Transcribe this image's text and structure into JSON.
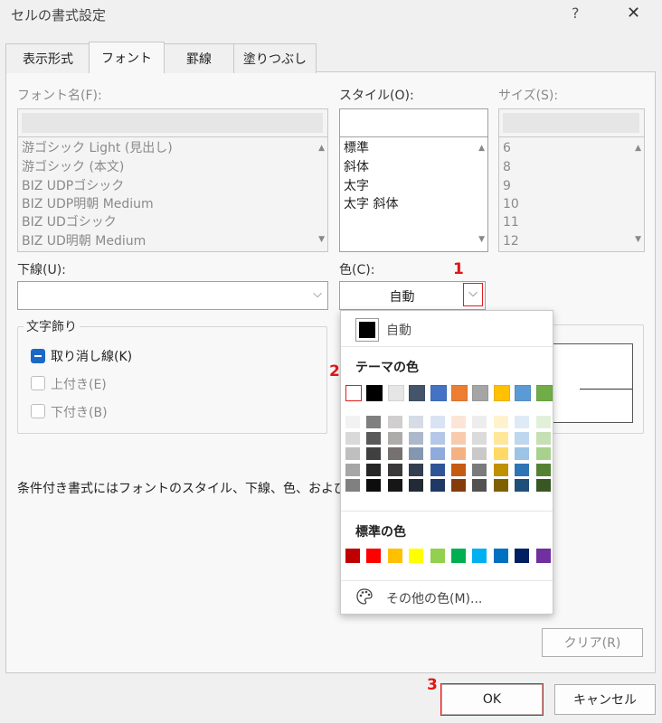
{
  "window": {
    "title": "セルの書式設定",
    "help": "?",
    "close": "✕"
  },
  "tabs": [
    {
      "label": "表示形式"
    },
    {
      "label": "フォント"
    },
    {
      "label": "罫線"
    },
    {
      "label": "塗りつぶし"
    }
  ],
  "font_name": {
    "label": "フォント名(F):",
    "items": [
      "游ゴシック Light (見出し)",
      "游ゴシック (本文)",
      "BIZ UDPゴシック",
      "BIZ UDP明朝 Medium",
      "BIZ UDゴシック",
      "BIZ UD明朝 Medium"
    ]
  },
  "style": {
    "label": "スタイル(O):",
    "items": [
      "標準",
      "斜体",
      "太字",
      "太字 斜体"
    ]
  },
  "size": {
    "label": "サイズ(S):",
    "items": [
      "6",
      "8",
      "9",
      "10",
      "11",
      "12"
    ]
  },
  "underline": {
    "label": "下線(U):",
    "value": ""
  },
  "color": {
    "label": "色(C):",
    "value": "自動"
  },
  "effects": {
    "title": "文字飾り",
    "strikethrough": "取り消し線(K)",
    "superscript": "上付き(E)",
    "subscript": "下付き(B)"
  },
  "info_text": "条件付き書式にはフォントのスタイル、下線、色、および取",
  "color_popup": {
    "auto_label": "自動",
    "theme_heading": "テーマの色",
    "theme_colors": [
      "#ffffff",
      "#000000",
      "#e7e6e6",
      "#44546a",
      "#4472c4",
      "#ed7d31",
      "#a5a5a5",
      "#ffc000",
      "#5b9bd5",
      "#70ad47"
    ],
    "theme_shades": [
      [
        "#f2f2f2",
        "#d9d9d9",
        "#bfbfbf",
        "#a6a6a6",
        "#808080"
      ],
      [
        "#7f7f7f",
        "#595959",
        "#404040",
        "#262626",
        "#0d0d0d"
      ],
      [
        "#d0cece",
        "#aeabab",
        "#757171",
        "#3a3838",
        "#171616"
      ],
      [
        "#d6dce5",
        "#adb9ca",
        "#8497b0",
        "#333f50",
        "#222a35"
      ],
      [
        "#dae3f3",
        "#b4c7e7",
        "#8faadc",
        "#2f5597",
        "#1f3864"
      ],
      [
        "#fbe5d6",
        "#f8cbad",
        "#f4b183",
        "#c55a11",
        "#843c0c"
      ],
      [
        "#ededed",
        "#dbdbdb",
        "#c9c9c9",
        "#7b7b7b",
        "#525252"
      ],
      [
        "#fff2cc",
        "#ffe699",
        "#ffd966",
        "#bf9000",
        "#7f6000"
      ],
      [
        "#deebf7",
        "#bdd7ee",
        "#9dc3e6",
        "#2e75b6",
        "#1f4e79"
      ],
      [
        "#e2f0d9",
        "#c5e0b4",
        "#a9d18e",
        "#548235",
        "#385723"
      ]
    ],
    "standard_heading": "標準の色",
    "standard_colors": [
      "#c00000",
      "#ff0000",
      "#ffc000",
      "#ffff00",
      "#92d050",
      "#00b050",
      "#00b0f0",
      "#0070c0",
      "#002060",
      "#7030a0"
    ],
    "more_colors": "その他の色(M)..."
  },
  "buttons": {
    "clear": "クリア(R)",
    "ok": "OK",
    "cancel": "キャンセル"
  },
  "steps": [
    "1",
    "2",
    "3"
  ]
}
